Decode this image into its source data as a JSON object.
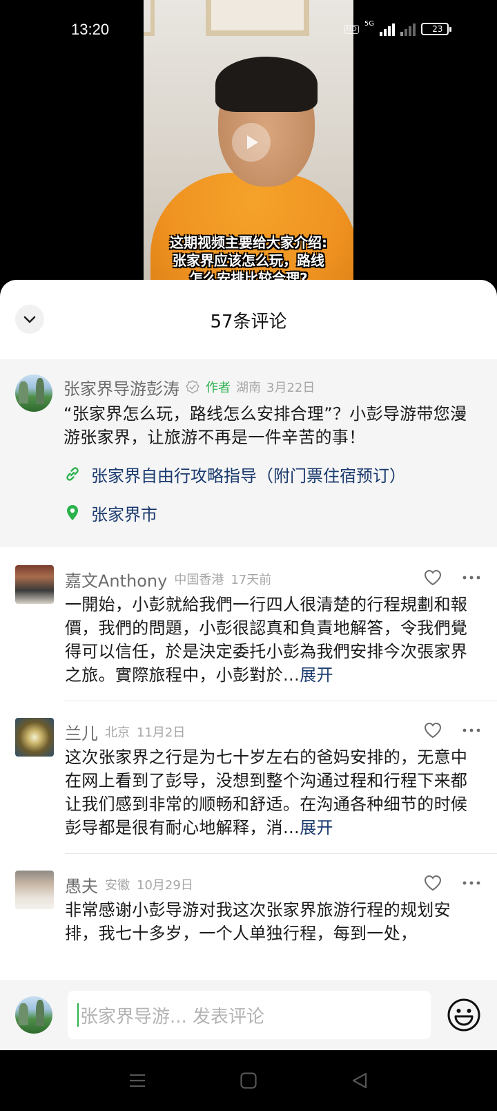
{
  "status_bar": {
    "time": "13:20",
    "hd": "HD",
    "network": "5G",
    "battery": "23",
    "battery_level_percent": 23
  },
  "video": {
    "caption_lines": [
      "这期视频主要给大家介绍:",
      "张家界应该怎么玩，路线"
    ],
    "caption_partial": "怎么安排比较合理?"
  },
  "sheet": {
    "title": "57条评论"
  },
  "author_post": {
    "name": "张家界导游彭涛",
    "tag": "作者",
    "location": "湖南",
    "date": "3月22日",
    "text": "“张家界怎么玩，路线怎么安排合理”？小彭导游带您漫游张家界，让旅游不再是一件辛苦的事！",
    "link_text": "张家界自由行攻略指导（附门票住宿预订）",
    "place": "张家界市"
  },
  "comments": [
    {
      "name": "嘉文Anthony",
      "location": "中国香港",
      "time": "17天前",
      "text": "一開始，小彭就給我們一行四人很清楚的行程規劃和報價，我們的問題，小彭很認真和負責地解答，令我們覺得可以信任，於是決定委托小彭為我們安排今次張家界之旅。實際旅程中，小彭對於…",
      "expand": "展开"
    },
    {
      "name": "兰儿",
      "location": "北京",
      "time": "11月2日",
      "text": "这次张家界之行是为七十岁左右的爸妈安排的，无意中在网上看到了彭导，没想到整个沟通过程和行程下来都让我们感到非常的顺畅和舒适。在沟通各种细节的时候彭导都是很有耐心地解释，消…",
      "expand": "展开"
    },
    {
      "name": "愚夫",
      "location": "安徽",
      "time": "10月29日",
      "text": "非常感谢小彭导游对我这次张家界旅游行程的规划安排，我七十多岁，一个人单独行程，每到一处，",
      "expand": ""
    }
  ],
  "input_bar": {
    "placeholder": "张家界导游... 发表评论"
  },
  "colors": {
    "accent_green": "#2bb24c",
    "link_blue": "#1a3a6e",
    "gray_text": "#6d6d6d"
  },
  "icons": [
    "chevron-down-icon",
    "verified-icon",
    "link-icon",
    "location-pin-icon",
    "heart-icon",
    "more-icon",
    "emoji-icon",
    "menu-icon",
    "home-icon",
    "back-icon",
    "play-icon"
  ]
}
